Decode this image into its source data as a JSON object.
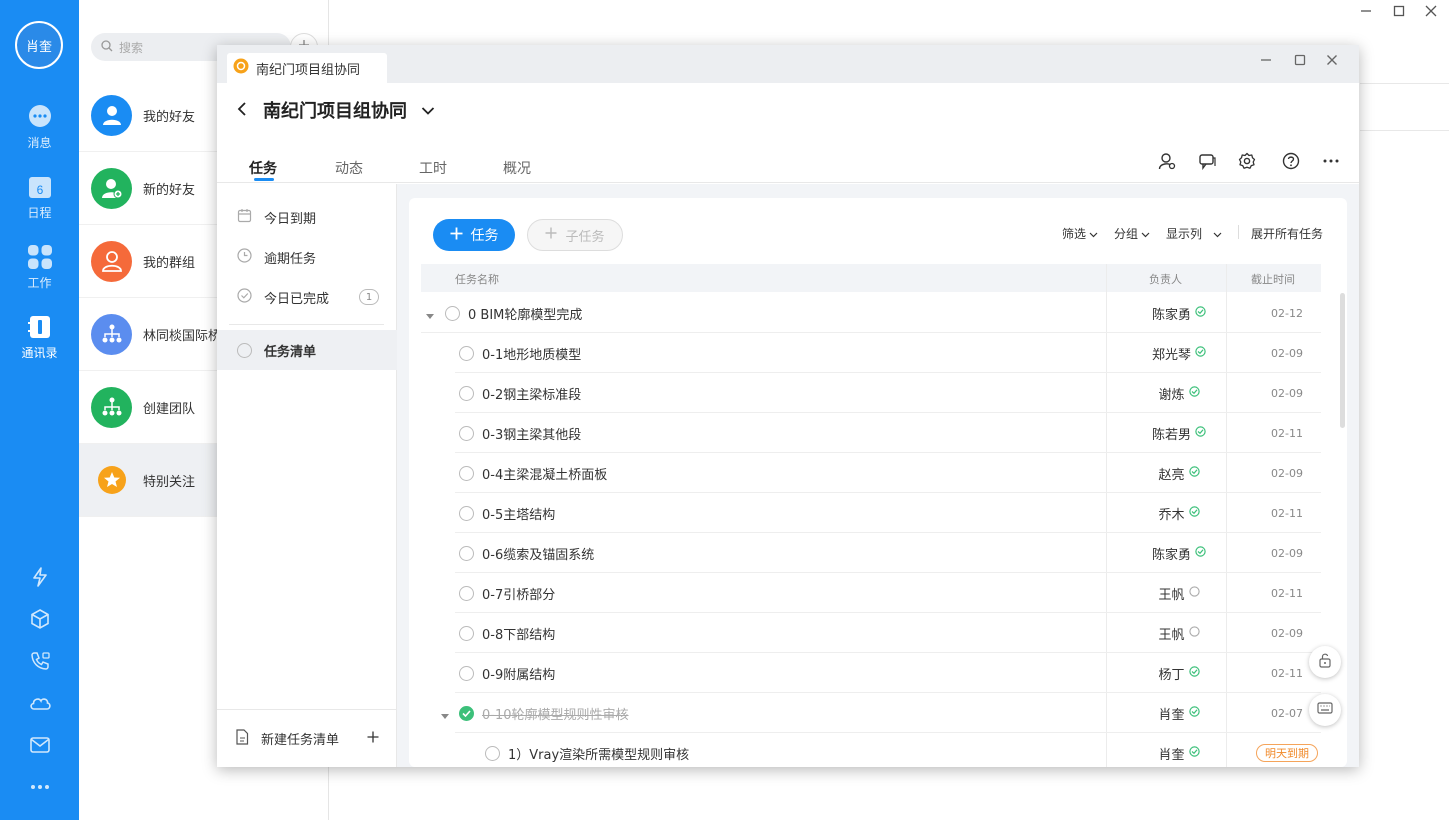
{
  "rail": {
    "avatar_text": "肖奎",
    "items": [
      {
        "label": "消息",
        "icon": "chat-bubble-icon"
      },
      {
        "label": "日程",
        "icon": "calendar-icon",
        "day": "6"
      },
      {
        "label": "工作",
        "icon": "apps-grid-icon"
      },
      {
        "label": "通讯录",
        "icon": "contacts-book-icon"
      }
    ],
    "bottom_icons": [
      "lightning-icon",
      "cube-icon",
      "phone-icon",
      "cloud-icon",
      "mail-icon",
      "more-dots-icon"
    ]
  },
  "contacts": {
    "search_placeholder": "搜索",
    "items": [
      {
        "label": "我的好友",
        "color": "#1a8cf3"
      },
      {
        "label": "新的好友",
        "color": "#22b35e"
      },
      {
        "label": "我的群组",
        "color": "#f56a3a"
      },
      {
        "label": "林同棪国际桥",
        "color": "#5b8def"
      },
      {
        "label": "创建团队",
        "color": "#22b35e"
      },
      {
        "label": "特别关注",
        "color": "#f7a21a"
      }
    ]
  },
  "popup": {
    "tab_title": "南纪门项目组协同",
    "project_title": "南纪门项目组协同",
    "nav_tabs": [
      "任务",
      "动态",
      "工时",
      "概况"
    ],
    "sidebar": {
      "items": [
        {
          "label": "今日到期",
          "icon": "calendar-icon"
        },
        {
          "label": "逾期任务",
          "icon": "clock-icon"
        },
        {
          "label": "今日已完成",
          "icon": "check-circle-icon",
          "count": "1"
        }
      ],
      "list_item": "任务清单",
      "new_list": "新建任务清单"
    },
    "toolbar": {
      "add_task": "任务",
      "add_subtask": "子任务",
      "filter": "筛选",
      "group": "分组",
      "columns": "显示列",
      "expand_all": "展开所有任务"
    },
    "table": {
      "headers": [
        "任务名称",
        "负责人",
        "截止时间"
      ],
      "rows": [
        {
          "name": "0 BIM轮廓模型完成",
          "owner": "陈家勇",
          "date": "02-12",
          "level": 0,
          "state": "open",
          "owner_done": true
        },
        {
          "name": "0-1地形地质模型",
          "owner": "郑光琴",
          "date": "02-09",
          "level": 1,
          "state": "open",
          "owner_done": true
        },
        {
          "name": "0-2钢主梁标准段",
          "owner": "谢炼",
          "date": "02-09",
          "level": 1,
          "state": "open",
          "owner_done": true
        },
        {
          "name": "0-3钢主梁其他段",
          "owner": "陈若男",
          "date": "02-11",
          "level": 1,
          "state": "open",
          "owner_done": true
        },
        {
          "name": "0-4主梁混凝土桥面板",
          "owner": "赵亮",
          "date": "02-09",
          "level": 1,
          "state": "open",
          "owner_done": true
        },
        {
          "name": "0-5主塔结构",
          "owner": "乔木",
          "date": "02-11",
          "level": 1,
          "state": "open",
          "owner_done": true
        },
        {
          "name": "0-6缆索及锚固系统",
          "owner": "陈家勇",
          "date": "02-09",
          "level": 1,
          "state": "open",
          "owner_done": true
        },
        {
          "name": "0-7引桥部分",
          "owner": "王帆",
          "date": "02-11",
          "level": 1,
          "state": "open",
          "owner_done": false
        },
        {
          "name": "0-8下部结构",
          "owner": "王帆",
          "date": "02-09",
          "level": 1,
          "state": "open",
          "owner_done": false
        },
        {
          "name": "0-9附属结构",
          "owner": "杨丁",
          "date": "02-11",
          "level": 1,
          "state": "open",
          "owner_done": true
        },
        {
          "name": "0-10轮廓模型规则性审核",
          "owner": "肖奎",
          "date": "02-07",
          "level": 1,
          "state": "done",
          "owner_done": true
        },
        {
          "name": "1）Vray渲染所需模型规则审核",
          "owner": "肖奎",
          "date": "明天到期",
          "level": 2,
          "state": "open",
          "owner_done": true
        }
      ]
    }
  },
  "colors": {
    "accent": "#1a8cf3",
    "done_green": "#3cc07a",
    "due_orange": "#f08a2a"
  }
}
